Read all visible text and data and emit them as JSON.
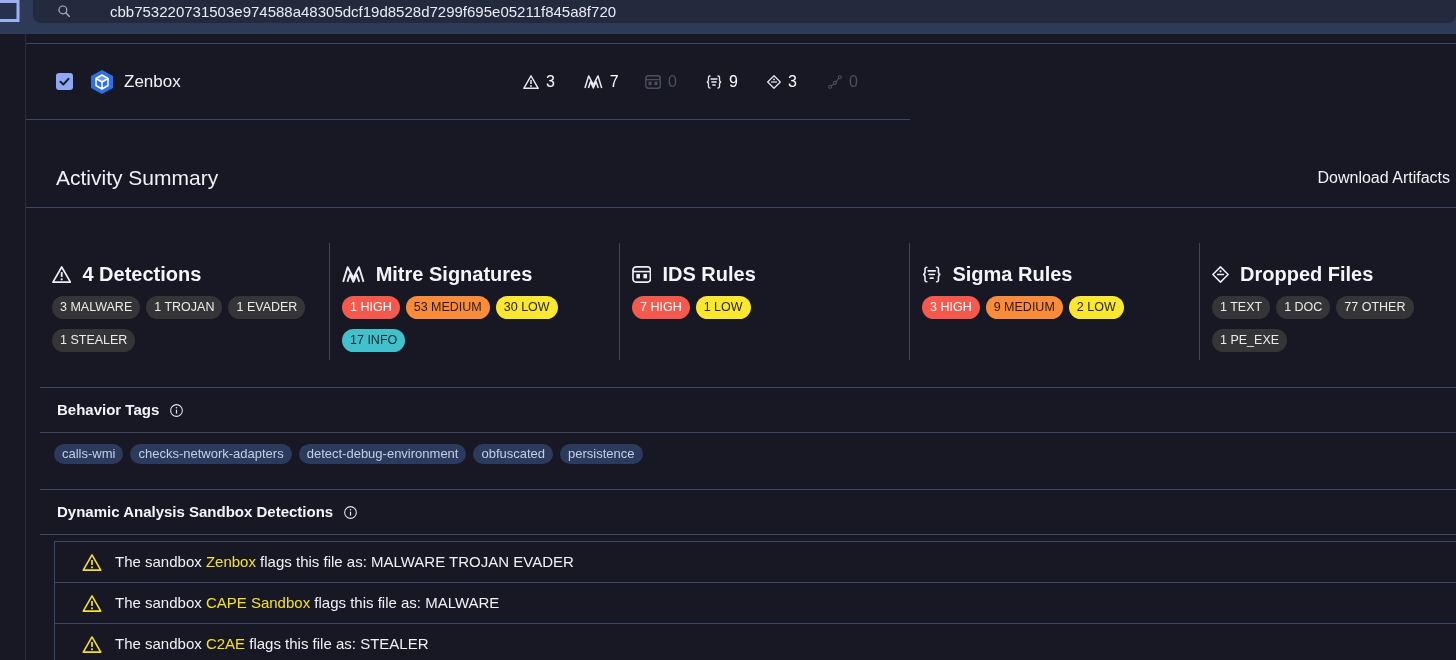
{
  "header": {
    "search": {
      "value": "cbb753220731503e974588a48305dcf19d8528d7299f695e05211f845a8f720"
    }
  },
  "sandbox": {
    "checked": true,
    "name": "Zenbox",
    "counts": [
      {
        "kind": "detections",
        "value": "3",
        "disabled": false
      },
      {
        "kind": "mitre",
        "value": "7",
        "disabled": false
      },
      {
        "kind": "ids",
        "value": "0",
        "disabled": true
      },
      {
        "kind": "sigma",
        "value": "9",
        "disabled": false
      },
      {
        "kind": "dropped",
        "value": "3",
        "disabled": false
      },
      {
        "kind": "network",
        "value": "0",
        "disabled": true
      }
    ]
  },
  "activity_summary": {
    "title": "Activity Summary",
    "download_button": "Download Artifacts"
  },
  "summary_cards": [
    {
      "kind": "detections",
      "title": "4 Detections",
      "badges": [
        {
          "label": "3 MALWARE",
          "kind": "neutral"
        },
        {
          "label": "1 TROJAN",
          "kind": "neutral"
        },
        {
          "label": "1 EVADER",
          "kind": "neutral"
        },
        {
          "label": "1 STEALER",
          "kind": "neutral"
        }
      ]
    },
    {
      "kind": "mitre",
      "title": "Mitre Signatures",
      "badges": [
        {
          "label": "1 HIGH",
          "kind": "high"
        },
        {
          "label": "53 MEDIUM",
          "kind": "medium"
        },
        {
          "label": "30 LOW",
          "kind": "low"
        },
        {
          "label": "17 INFO",
          "kind": "info"
        }
      ]
    },
    {
      "kind": "ids",
      "title": "IDS Rules",
      "badges": [
        {
          "label": "7 HIGH",
          "kind": "high"
        },
        {
          "label": "1 LOW",
          "kind": "low"
        }
      ]
    },
    {
      "kind": "sigma",
      "title": "Sigma Rules",
      "badges": [
        {
          "label": "3 HIGH",
          "kind": "high"
        },
        {
          "label": "9 MEDIUM",
          "kind": "medium"
        },
        {
          "label": "2 LOW",
          "kind": "low"
        }
      ]
    },
    {
      "kind": "dropped",
      "title": "Dropped Files",
      "badges": [
        {
          "label": "1 TEXT",
          "kind": "neutral"
        },
        {
          "label": "1 DOC",
          "kind": "neutral"
        },
        {
          "label": "77 OTHER",
          "kind": "neutral"
        },
        {
          "label": "1 PE_EXE",
          "kind": "neutral"
        }
      ]
    }
  ],
  "behavior_tags": {
    "title": "Behavior Tags",
    "tags": [
      "calls-wmi",
      "checks-network-adapters",
      "detect-debug-environment",
      "obfuscated",
      "persistence"
    ]
  },
  "sandbox_detections": {
    "title": "Dynamic Analysis Sandbox Detections",
    "rows": [
      {
        "prefix": "The sandbox",
        "sandbox": "Zenbox",
        "suffix": "flags this file as: MALWARE TROJAN EVADER"
      },
      {
        "prefix": "The sandbox",
        "sandbox": "CAPE Sandbox",
        "suffix": "flags this file as: MALWARE"
      },
      {
        "prefix": "The sandbox",
        "sandbox": "C2AE",
        "suffix": "flags this file as: STEALER"
      }
    ]
  }
}
